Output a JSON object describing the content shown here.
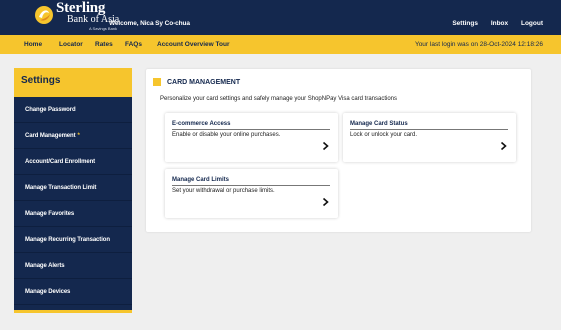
{
  "header": {
    "brand_name": "Sterling",
    "brand_sub": "Bank of Asia",
    "brand_tag": "A Savings Bank",
    "welcome": "Welcome, Nica Sy Co-chua",
    "links": [
      "Settings",
      "Inbox",
      "Logout"
    ]
  },
  "nav": {
    "items": [
      "Home",
      "Locator",
      "Rates",
      "FAQs",
      "Account Overview Tour"
    ],
    "last_login": "Your last login was on 28-Oct-2024 12:18:26"
  },
  "sidebar": {
    "title": "Settings",
    "items": [
      {
        "label": "Change Password"
      },
      {
        "label": "Card Management",
        "marker": "*"
      },
      {
        "label": "Account/Card Enrollment"
      },
      {
        "label": "Manage Transaction Limit"
      },
      {
        "label": "Manage Favorites"
      },
      {
        "label": "Manage Recurring Transaction"
      },
      {
        "label": "Manage Alerts"
      },
      {
        "label": "Manage Devices"
      }
    ]
  },
  "main": {
    "title": "CARD MANAGEMENT",
    "description": "Personalize your card settings and safely manage your ShopNPay Visa card transactions",
    "cards": [
      {
        "title": "E-commerce Access",
        "desc": "Enable or disable your online purchases.",
        "icon": "chevron-right-icon"
      },
      {
        "title": "Manage Card Status",
        "desc": "Lock or unlock your card.",
        "icon": "chevron-right-icon"
      },
      {
        "title": "Manage Card Limits",
        "desc": "Set your withdrawal or purchase limits.",
        "icon": "chevron-right-icon"
      }
    ]
  },
  "colors": {
    "navy": "#14284e",
    "gold": "#f6c52d",
    "background": "#efefef"
  }
}
